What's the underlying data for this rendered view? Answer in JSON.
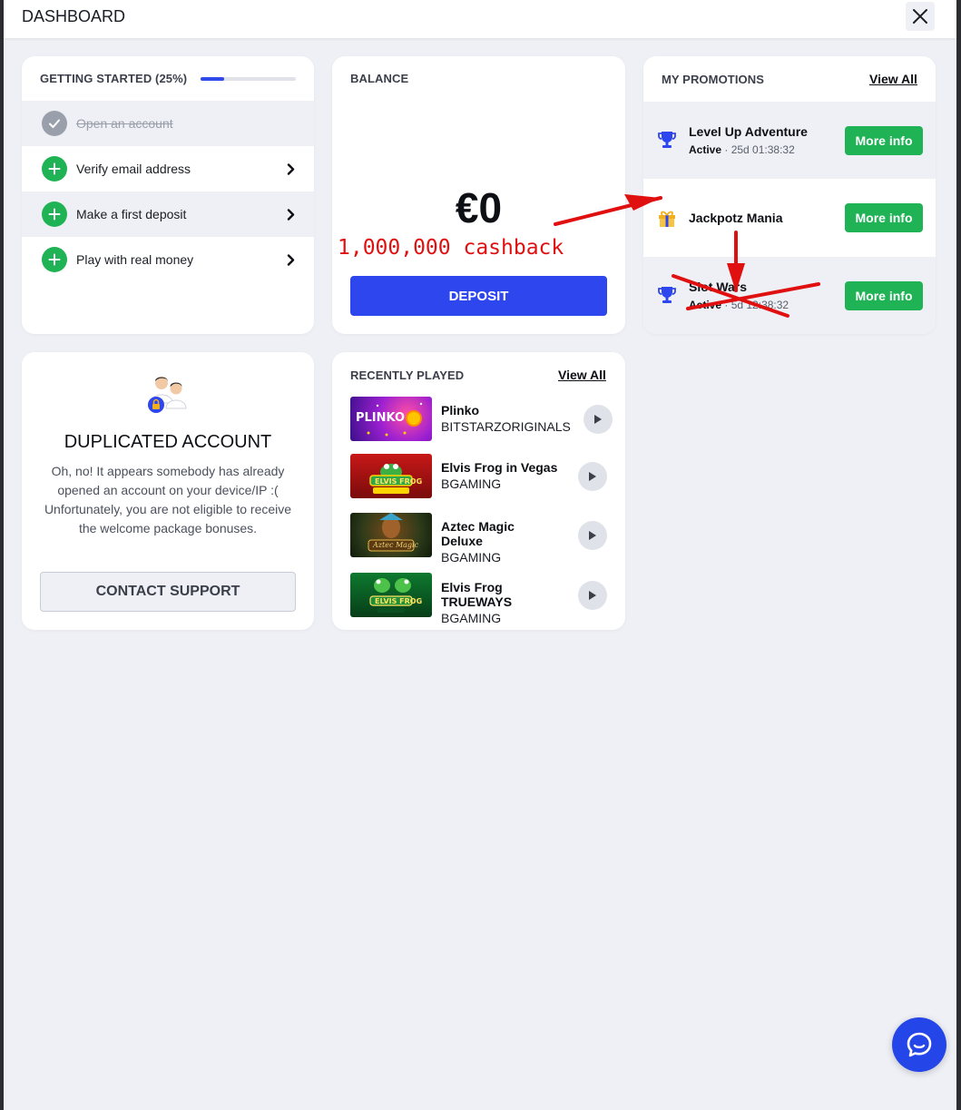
{
  "header": {
    "title": "DASHBOARD",
    "close_icon": "close-icon"
  },
  "getting_started": {
    "title": "GETTING STARTED (25%)",
    "progress": 0.25,
    "items": [
      {
        "label": "Open an account",
        "done": true
      },
      {
        "label": "Verify email address",
        "done": false
      },
      {
        "label": "Make a first deposit",
        "done": false
      },
      {
        "label": "Play with real money",
        "done": false
      }
    ]
  },
  "balance": {
    "title": "BALANCE",
    "amount": "€0",
    "annotation": "1,000,000 cashback",
    "deposit_label": "DEPOSIT"
  },
  "promotions": {
    "title": "MY PROMOTIONS",
    "view_all": "View All",
    "items": [
      {
        "name": "Level Up Adventure",
        "status": "Active",
        "timer": "25d 01:38:32",
        "icon": "trophy-icon",
        "button": "More info"
      },
      {
        "name": "Jackpotz Mania",
        "icon": "gift-icon",
        "button": "More info"
      },
      {
        "name": "Slot Wars",
        "status": "Active",
        "timer": "5d 12:38:32",
        "icon": "trophy-icon",
        "button": "More info"
      }
    ]
  },
  "duplicated": {
    "title": "DUPLICATED ACCOUNT",
    "body": "Oh, no! It appears somebody has already opened an account on your device/IP :( Unfortunately, you are not eligible to receive the welcome package bonuses.",
    "button": "CONTACT SUPPORT"
  },
  "recently_played": {
    "title": "RECENTLY PLAYED",
    "view_all": "View All",
    "games": [
      {
        "title": "Plinko",
        "provider": "BITSTARZORIGINALS",
        "thumb_text": "PLINKO"
      },
      {
        "title": "Elvis Frog in Vegas",
        "provider": "BGAMING",
        "thumb_text": "ELVIS FROG"
      },
      {
        "title": "Aztec Magic Deluxe",
        "provider": "BGAMING",
        "thumb_text": "Aztec Magic"
      },
      {
        "title": "Elvis Frog TRUEWAYS",
        "provider": "BGAMING",
        "thumb_text": "ELVIS FROG"
      }
    ]
  },
  "chat": {
    "icon": "chat-icon"
  },
  "colors": {
    "accent_blue": "#2e46ee",
    "success_green": "#1fb356",
    "annotation_red": "#e01010"
  }
}
